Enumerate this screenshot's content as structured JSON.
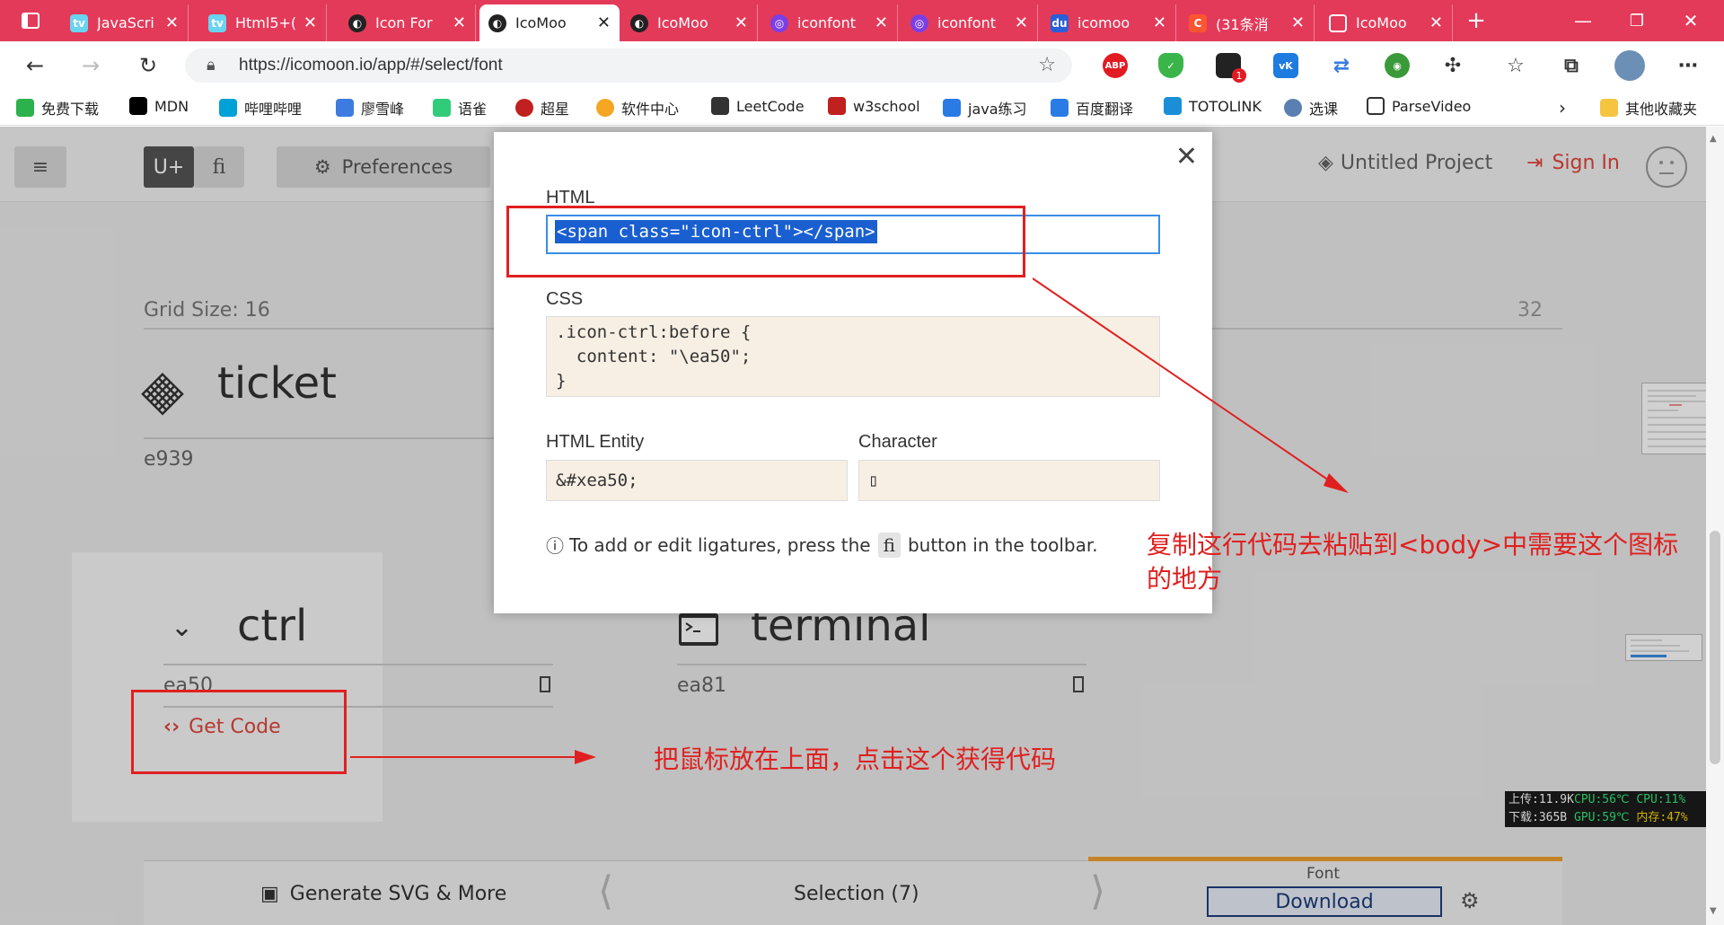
{
  "browser": {
    "tabs": [
      {
        "title": "JavaScri",
        "icon": "bilibili-icon",
        "color": "#ffffff"
      },
      {
        "title": "Html5+(",
        "icon": "bilibili-icon",
        "color": "#ffffff"
      },
      {
        "title": "Icon For",
        "icon": "icomoon-icon",
        "color": "#ffffff"
      },
      {
        "title": "IcoMoo",
        "icon": "icomoon-icon",
        "color": "#ffffff"
      },
      {
        "title": "IcoMoo",
        "icon": "icomoon-icon",
        "color": "#ffffff"
      },
      {
        "title": "iconfont",
        "icon": "iconfont-icon",
        "color": "#ffffff"
      },
      {
        "title": "iconfont",
        "icon": "iconfont-icon",
        "color": "#ffffff"
      },
      {
        "title": "icomoo",
        "icon": "baidu-icon",
        "color": "#ffffff"
      },
      {
        "title": "(31条消",
        "icon": "csdn-icon",
        "color": "#ffffff"
      },
      {
        "title": "IcoMoo",
        "icon": "page-icon",
        "color": "#ffffff"
      }
    ],
    "active_tab_index": 3,
    "new_tab_symbol": "+",
    "url": "https://icomoon.io/app/#/select/font",
    "extension_badge": "1",
    "bookmarks": [
      {
        "label": "免费下载",
        "color": "#2bb24c"
      },
      {
        "label": "MDN",
        "color": "#000000"
      },
      {
        "label": "哔哩哔哩",
        "color": "#00a1d6"
      },
      {
        "label": "廖雪峰",
        "color": "#3d7be0"
      },
      {
        "label": "语雀",
        "color": "#31cc79"
      },
      {
        "label": "超星",
        "color": "#c0201f"
      },
      {
        "label": "软件中心",
        "color": "#f5a623"
      },
      {
        "label": "LeetCode",
        "color": "#333333"
      },
      {
        "label": "w3school",
        "color": "#c0201f"
      },
      {
        "label": "java练习",
        "color": "#2a7be4"
      },
      {
        "label": "百度翻译",
        "color": "#2a7be4"
      },
      {
        "label": "TOTOLINK",
        "color": "#1a8fd8"
      },
      {
        "label": "选课",
        "color": "#5a7fb0"
      },
      {
        "label": "ParseVideo",
        "color": "#ffffff"
      }
    ],
    "other_bookmarks": "其他收藏夹"
  },
  "app": {
    "toolbar": {
      "unicode_btn": "U+",
      "ligature_btn": "ﬁ",
      "preferences": "Preferences",
      "project": "Untitled Project",
      "sign_in": "Sign In"
    },
    "grid_label": "Grid Size: 16",
    "grid_max": "32",
    "glyphs": [
      {
        "name": "ticket",
        "code": "e939"
      },
      {
        "name": "ctrl",
        "code": "ea50"
      },
      {
        "name": "terminal",
        "code": "ea81"
      }
    ],
    "get_code": "Get Code",
    "bottom": {
      "generate": "Generate SVG & More",
      "selection": "Selection (7)",
      "font_label": "Font",
      "download": "Download"
    }
  },
  "modal": {
    "html_label": "HTML",
    "html_value": "<span class=\"icon-ctrl\"></span>",
    "css_label": "CSS",
    "css_value": ".icon-ctrl:before {\n  content: \"\\ea50\";\n}",
    "entity_label": "HTML Entity",
    "entity_value": "&#xea50;",
    "char_label": "Character",
    "char_value": "▯",
    "note_before": "To add or edit ligatures, press the",
    "note_key": "ﬁ",
    "note_after": "button in the toolbar."
  },
  "annotations": {
    "copy_note": "复制这行代码去粘贴到<body>中需要这个图标的地方",
    "hover_note": "把鼠标放在上面，点击这个获得代码"
  },
  "system_monitor": {
    "upload": "上传:11.9K",
    "download": "下载:365B",
    "cpu_temp": "CPU:56℃",
    "gpu_temp": "GPU:59℃",
    "cpu_load": "CPU:11%",
    "memory": "内存:47%"
  }
}
